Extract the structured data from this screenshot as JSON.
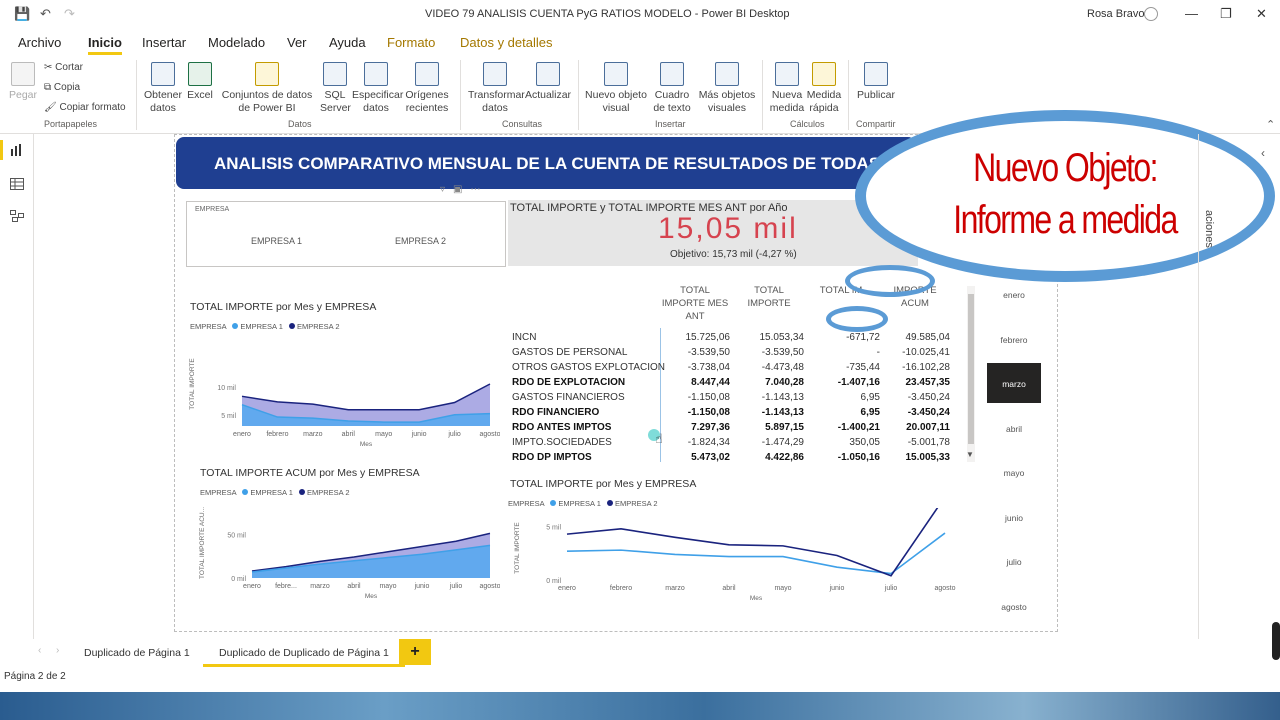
{
  "window": {
    "title": "VIDEO 79 ANALISIS CUENTA PyG RATIOS MODELO - Power BI Desktop",
    "user": "Rosa Bravo"
  },
  "menu": {
    "items": [
      "Archivo",
      "Inicio",
      "Insertar",
      "Modelado",
      "Ver",
      "Ayuda",
      "Formato",
      "Datos y detalles"
    ],
    "active": "Inicio"
  },
  "ribbon": {
    "clipboard": {
      "paste": "Pegar",
      "cut": "Cortar",
      "copy": "Copia",
      "format": "Copiar formato",
      "group": "Portapapeles"
    },
    "data": {
      "get": "Obtener datos",
      "excel": "Excel",
      "datasets": "Conjuntos de datos de Power BI",
      "sql": "SQL Server",
      "enter": "Especificar datos",
      "recent": "Orígenes recientes",
      "group": "Datos"
    },
    "queries": {
      "transform": "Transformar datos",
      "refresh": "Actualizar",
      "group": "Consultas"
    },
    "insert": {
      "visual": "Nuevo objeto visual",
      "textbox": "Cuadro de texto",
      "more": "Más objetos visuales",
      "group": "Insertar"
    },
    "calcs": {
      "measure": "Nueva medida",
      "quick": "Medida rápida",
      "group": "Cálculos"
    },
    "share": {
      "publish": "Publicar",
      "group": "Compartir"
    }
  },
  "banner": "ANALISIS COMPARATIVO MENSUAL DE LA CUENTA DE RESULTADOS DE TODAS",
  "overlay": {
    "line1": "Nuevo Objeto:",
    "line2": "Informe a medida"
  },
  "slicer": {
    "header": "EMPRESA",
    "options": [
      "EMPRESA 1",
      "EMPRESA 2"
    ]
  },
  "kpi": {
    "title": "TOTAL IMPORTE y TOTAL IMPORTE MES ANT por Año",
    "value": "15,05 mil",
    "goal": "Objetivo: 15,73 mil (-4,27 %)"
  },
  "colors": {
    "empresa1": "#3fa0e8",
    "empresa2": "#1a237e",
    "accent": "#f2c811",
    "banner": "#1f3f91"
  },
  "matrix": {
    "headers": [
      "TOTAL IMPORTE MES ANT",
      "TOTAL IMPORTE",
      "TOTAL IM...",
      "IMPORTE ACUM"
    ],
    "rows": [
      {
        "label": "INCN",
        "values": [
          "15.725,06",
          "15.053,34",
          "-671,72",
          "49.585,04"
        ],
        "bold": false
      },
      {
        "label": "GASTOS DE PERSONAL",
        "values": [
          "-3.539,50",
          "-3.539,50",
          "-",
          "-10.025,41"
        ],
        "bold": false
      },
      {
        "label": "OTROS GASTOS EXPLOTACION",
        "values": [
          "-3.738,04",
          "-4.473,48",
          "-735,44",
          "-16.102,28"
        ],
        "bold": false
      },
      {
        "label": "RDO DE EXPLOTACION",
        "values": [
          "8.447,44",
          "7.040,28",
          "-1.407,16",
          "23.457,35"
        ],
        "bold": true
      },
      {
        "label": "GASTOS FINANCIEROS",
        "values": [
          "-1.150,08",
          "-1.143,13",
          "6,95",
          "-3.450,24"
        ],
        "bold": false
      },
      {
        "label": "RDO FINANCIERO",
        "values": [
          "-1.150,08",
          "-1.143,13",
          "6,95",
          "-3.450,24"
        ],
        "bold": true
      },
      {
        "label": "RDO ANTES IMPTOS",
        "values": [
          "7.297,36",
          "5.897,15",
          "-1.400,21",
          "20.007,11"
        ],
        "bold": true
      },
      {
        "label": "IMPTO.SOCIEDADES",
        "values": [
          "-1.824,34",
          "-1.474,29",
          "350,05",
          "-5.001,78"
        ],
        "bold": false
      },
      {
        "label": "RDO DP IMPTOS",
        "values": [
          "5.473,02",
          "4.422,86",
          "-1.050,16",
          "15.005,33"
        ],
        "bold": true
      }
    ]
  },
  "month_slicer": {
    "items": [
      "enero",
      "febrero",
      "marzo",
      "abril",
      "mayo",
      "junio",
      "julio",
      "agosto"
    ],
    "selected": "marzo"
  },
  "right_panel": {
    "label": "aciones"
  },
  "tabs": {
    "items": [
      "Duplicado de Página 1",
      "Duplicado de Duplicado de Página 1"
    ],
    "active": 1,
    "add": "+"
  },
  "status": "Página 2 de 2",
  "chart_data": [
    {
      "type": "area",
      "title": "TOTAL IMPORTE por Mes y EMPRESA",
      "legend_title": "EMPRESA",
      "xlabel": "Mes",
      "ylabel": "TOTAL IMPORTE",
      "categories": [
        "enero",
        "febrero",
        "marzo",
        "abril",
        "mayo",
        "junio",
        "julio",
        "agosto"
      ],
      "yticks": [
        "5 mil",
        "10 mil"
      ],
      "ylim": [
        3000,
        18000
      ],
      "series": [
        {
          "name": "EMPRESA 1",
          "values": [
            8300,
            7300,
            6900,
            5900,
            5900,
            5900,
            7200,
            10500
          ]
        },
        {
          "name": "EMPRESA 2",
          "values": [
            6800,
            4600,
            4400,
            3900,
            3700,
            3700,
            5000,
            5200
          ]
        }
      ]
    },
    {
      "type": "area",
      "title": "TOTAL IMPORTE ACUM por Mes y EMPRESA",
      "legend_title": "EMPRESA",
      "xlabel": "Mes",
      "ylabel": "TOTAL IMPORTE ACU...",
      "categories": [
        "enero",
        "febre...",
        "marzo",
        "abril",
        "mayo",
        "junio",
        "julio",
        "agosto"
      ],
      "yticks": [
        "0 mil",
        "50 mil"
      ],
      "ylim": [
        0,
        80000
      ],
      "series": [
        {
          "name": "EMPRESA 1",
          "values": [
            8000,
            13000,
            19000,
            24000,
            30000,
            36000,
            42000,
            51000
          ]
        },
        {
          "name": "EMPRESA 2",
          "values": [
            6800,
            11400,
            15800,
            19700,
            23400,
            27100,
            32100,
            37300
          ]
        }
      ]
    },
    {
      "type": "line",
      "title": "TOTAL IMPORTE por Mes y EMPRESA",
      "legend_title": "EMPRESA",
      "xlabel": "Mes",
      "ylabel": "TOTAL IMPORTE",
      "categories": [
        "enero",
        "febrero",
        "marzo",
        "abril",
        "mayo",
        "junio",
        "julio",
        "agosto"
      ],
      "yticks": [
        "0 mil",
        "5 mil"
      ],
      "ylim": [
        0,
        6000
      ],
      "series": [
        {
          "name": "EMPRESA 1",
          "values": [
            2700,
            2800,
            2400,
            2200,
            2200,
            1200,
            600,
            4400
          ]
        },
        {
          "name": "EMPRESA 2",
          "values": [
            4300,
            4800,
            4000,
            3300,
            3200,
            2300,
            400,
            7800
          ]
        }
      ]
    }
  ]
}
